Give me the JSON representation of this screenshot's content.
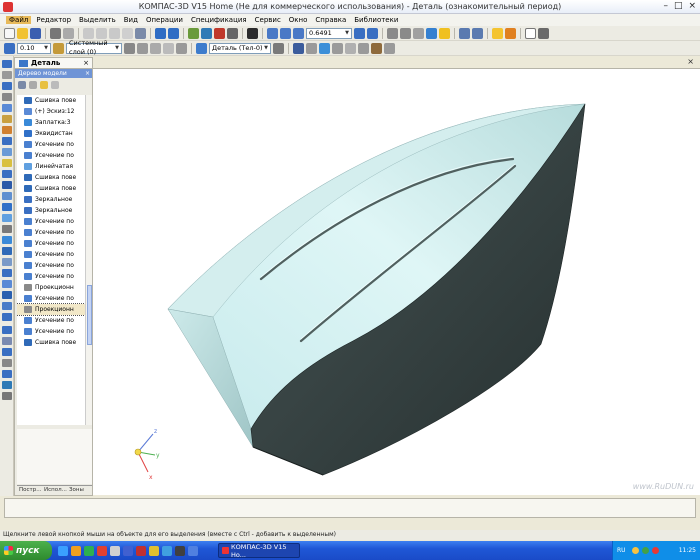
{
  "window": {
    "title": "КОМПАС-3D V15 Home (Не для коммерческого использования) - Деталь (ознакомительный период)",
    "controls": [
      "–",
      "□",
      "×"
    ]
  },
  "menu": [
    "Файл",
    "Редактор",
    "Выделить",
    "Вид",
    "Операции",
    "Спецификация",
    "Сервис",
    "Окно",
    "Справка",
    "Библиотеки"
  ],
  "toolbar": {
    "step_value": "0.10",
    "layer_value": "Системный слой (0)",
    "part_value": "Деталь (Тел-0)",
    "zoom_value": "0.6491"
  },
  "document_tab": {
    "label": "Деталь"
  },
  "tree_panel": {
    "title": "Дерево модели",
    "items": [
      {
        "label": "Сшивка пове",
        "icon": "stitch-surface-icon"
      },
      {
        "label": "(+) Эскиз:12",
        "icon": "sketch-icon"
      },
      {
        "label": "Заплатка:3",
        "icon": "patch-icon"
      },
      {
        "label": "Эквидистан",
        "icon": "offset-surface-icon"
      },
      {
        "label": "Усечение по",
        "icon": "trim-surface-icon"
      },
      {
        "label": "Усечение по",
        "icon": "trim-surface-icon"
      },
      {
        "label": "Линейчатая",
        "icon": "ruled-surface-icon"
      },
      {
        "label": "Сшивка пове",
        "icon": "stitch-surface-icon"
      },
      {
        "label": "Сшивка пове",
        "icon": "stitch-surface-icon"
      },
      {
        "label": "Зеркальное",
        "icon": "mirror-icon"
      },
      {
        "label": "Зеркальное",
        "icon": "mirror-icon"
      },
      {
        "label": "Усечение по",
        "icon": "trim-surface-icon"
      },
      {
        "label": "Усечение по",
        "icon": "trim-surface-icon"
      },
      {
        "label": "Усечение по",
        "icon": "trim-surface-icon"
      },
      {
        "label": "Усечение по",
        "icon": "trim-surface-icon"
      },
      {
        "label": "Усечение по",
        "icon": "trim-surface-icon"
      },
      {
        "label": "Усечение по",
        "icon": "trim-surface-icon"
      },
      {
        "label": "Проекционн",
        "icon": "projection-curve-icon"
      },
      {
        "label": "Усечение по",
        "icon": "trim-surface-icon"
      },
      {
        "label": "Проекционн",
        "icon": "projection-curve-icon"
      },
      {
        "label": "Усечение по",
        "icon": "trim-surface-icon"
      },
      {
        "label": "Усечение по",
        "icon": "trim-surface-icon"
      },
      {
        "label": "Сшивка пове",
        "icon": "stitch-surface-icon"
      }
    ],
    "selected_index": 19,
    "tabs": [
      "Постр...",
      "Испол...",
      "Зоны"
    ]
  },
  "viewport": {
    "watermark": "www.RuDUN.ru"
  },
  "status": {
    "hint": "Щелкните левой кнопкой мыши на объекте для его выделения (вместе с Ctrl - добавить к выделенным)"
  },
  "taskbar": {
    "start_label": "пуск",
    "task_label": "КОМПАС-3D V15 Ho...",
    "language": "RU",
    "clock": "11:25"
  },
  "colors": {
    "hull_top": "#cfeff0",
    "hull_side": "#2e3838",
    "accent": "#3a76c8"
  }
}
